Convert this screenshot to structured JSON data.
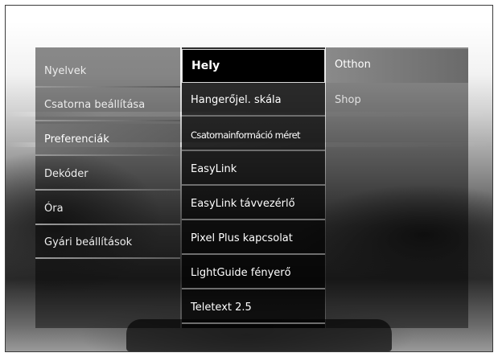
{
  "menu": {
    "level1": {
      "items": [
        {
          "label": "Nyelvek"
        },
        {
          "label": "Csatorna beállítása"
        },
        {
          "label": "Preferenciák"
        },
        {
          "label": "Dekóder"
        },
        {
          "label": "Óra"
        },
        {
          "label": "Gyári beállítások"
        }
      ],
      "active_label": "Preferenciák"
    },
    "level2": {
      "items": [
        {
          "label": "Hely"
        },
        {
          "label": "Hangerőjel. skála"
        },
        {
          "label": "Csatornainformáció méret"
        },
        {
          "label": "EasyLink"
        },
        {
          "label": "EasyLink távvezérlő"
        },
        {
          "label": "Pixel Plus kapcsolat"
        },
        {
          "label": "LightGuide fényerő"
        },
        {
          "label": "Teletext 2.5"
        }
      ],
      "selected_label": "Hely"
    },
    "level3": {
      "items": [
        {
          "label": "Otthon"
        },
        {
          "label": "Shop"
        }
      ],
      "highlighted_label": "Otthon"
    }
  },
  "colors": {
    "selected_border": "#d9d9d9",
    "highlight": "#8a8a8a",
    "panel_dark": "#000000"
  }
}
